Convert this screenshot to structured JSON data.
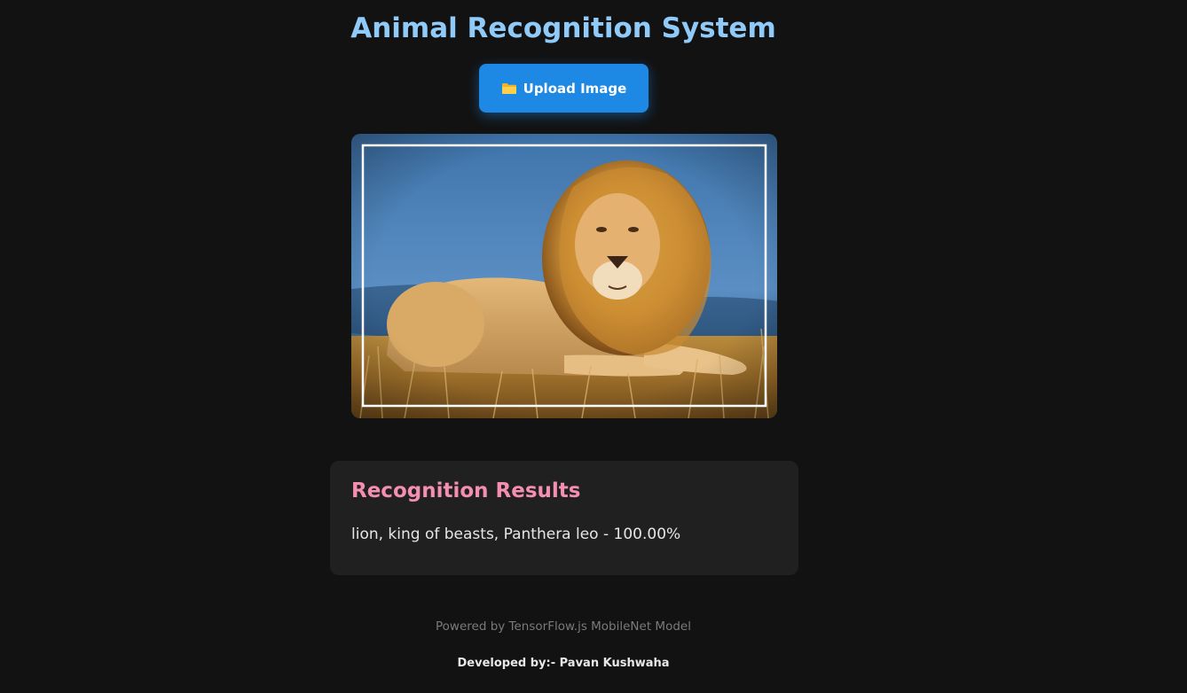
{
  "header": {
    "title": "Animal Recognition System"
  },
  "upload": {
    "label": "Upload Image",
    "icon": "folder-icon"
  },
  "preview": {
    "alt": "lion"
  },
  "results": {
    "title": "Recognition Results",
    "items": [
      "lion, king of beasts, Panthera leo - 100.00%"
    ]
  },
  "footer": {
    "powered": "Powered by TensorFlow.js MobileNet Model",
    "developed": "Developed by:- Pavan Kushwaha"
  },
  "colors": {
    "background": "#121212",
    "title": "#90caf9",
    "button": "#1e88e5",
    "results_title": "#f48fb1",
    "card": "#202020"
  }
}
